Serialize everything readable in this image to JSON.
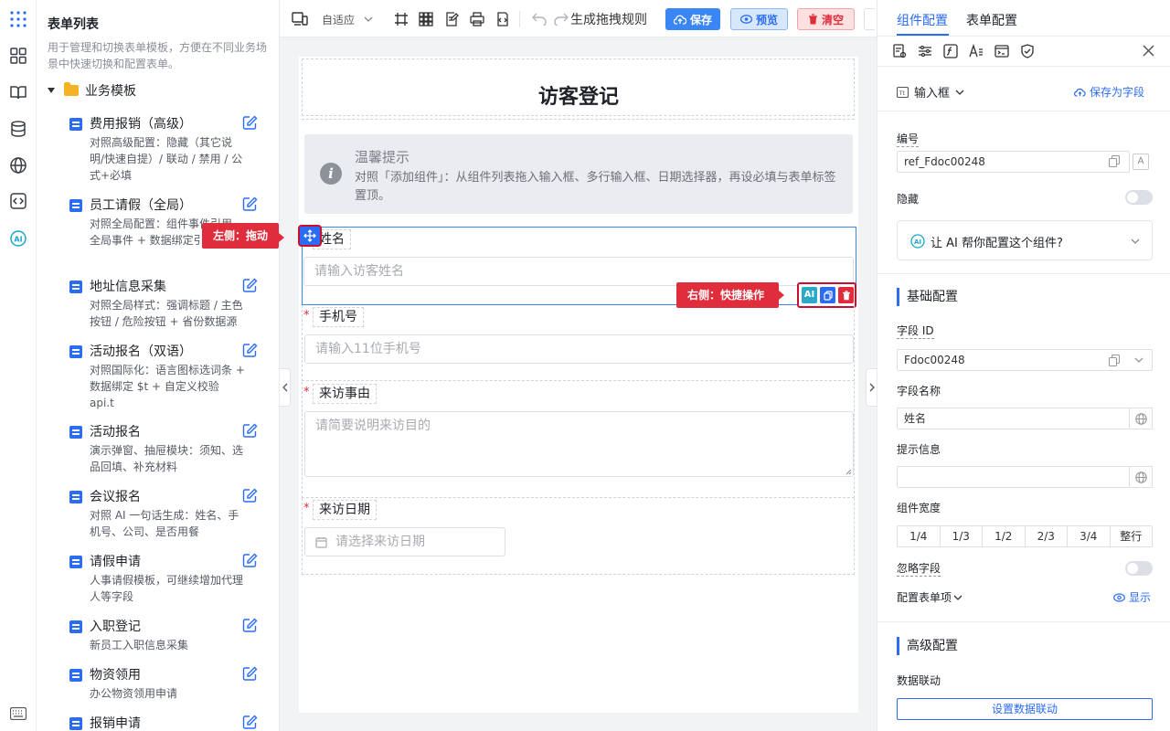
{
  "left_panel": {
    "title": "表单列表",
    "description": "用于管理和切换表单模板，方便在不同业务场景中快速切换和配置表单。",
    "group": "业务模板",
    "items": [
      {
        "title": "费用报销（高级）",
        "desc": "对照高级配置：隐藏（其它说明/快速自提）/ 联动 / 禁用 / 公式+必填"
      },
      {
        "title": "员工请假（全局）",
        "desc": "对照全局配置：组件事件引用 全局事件 + 数据绑定引用 变量"
      },
      {
        "title": "地址信息采集",
        "desc": "对照全局样式：强调标题 / 主色按钮 / 危险按钮 + 省份数据源"
      },
      {
        "title": "活动报名（双语）",
        "desc": "对照国际化：语言图标选词条 + 数据绑定 $t + 自定义校验 api.t"
      },
      {
        "title": "活动报名",
        "desc": "演示弹窗、抽屉模块：须知、选品回填、补充材料"
      },
      {
        "title": "会议报名",
        "desc": "对照 AI 一句话生成：姓名、手机号、公司、是否用餐"
      },
      {
        "title": "请假申请",
        "desc": "人事请假模板，可继续增加代理人等字段"
      },
      {
        "title": "入职登记",
        "desc": "新员工入职信息采集"
      },
      {
        "title": "物资领用",
        "desc": "办公物资领用申请"
      },
      {
        "title": "报销申请",
        "desc": ""
      }
    ]
  },
  "toolbar": {
    "adapt": "自适应",
    "rule_label": "生成拖拽规则",
    "save": "保存",
    "preview": "预览",
    "clear": "清空"
  },
  "form": {
    "title": "访客登记",
    "tip_title": "温馨提示",
    "tip_text": "对照「添加组件」：从组件列表拖入输入框、多行输入框、日期选择器，再设必填与表单标签置顶。",
    "fields": [
      {
        "label": "姓名",
        "placeholder": "请输入访客姓名",
        "required": false
      },
      {
        "label": "手机号",
        "placeholder": "请输入11位手机号",
        "required": true
      },
      {
        "label": "来访事由",
        "placeholder": "请简要说明来访目的",
        "required": true
      },
      {
        "label": "来访日期",
        "placeholder": "请选择来访日期",
        "required": true
      }
    ],
    "required_mark": "*",
    "callout_left": "左侧：拖动",
    "callout_right": "右侧：快捷操作",
    "ai_badge": "AI"
  },
  "right_panel": {
    "tabs": [
      "组件配置",
      "表单配置"
    ],
    "component_type": "输入框",
    "save_as_field": "保存为字段",
    "number_label": "编号",
    "number_value": "ref_Fdoc00248",
    "hidden_label": "隐藏",
    "ai_help": "让 AI 帮你配置这个组件?",
    "basic_section": "基础配置",
    "field_id_label": "字段 ID",
    "field_id_value": "Fdoc00248",
    "field_name_label": "字段名称",
    "field_name_value": "姓名",
    "hint_label": "提示信息",
    "hint_value": "",
    "width_label": "组件宽度",
    "width_options": [
      "1/4",
      "1/3",
      "1/2",
      "2/3",
      "3/4",
      "整行"
    ],
    "ignore_label": "忽略字段",
    "config_items_label": "配置表单项",
    "show_label": "显示",
    "advanced_section": "高级配置",
    "linkage_label": "数据联动",
    "linkage_button": "设置数据联动"
  },
  "colors": {
    "primary": "#2b6cf5",
    "danger": "#e02d3c",
    "save_bg": "#3a86f5",
    "preview_bg": "#d7e7fc",
    "clear_bg": "#fde1e1"
  }
}
